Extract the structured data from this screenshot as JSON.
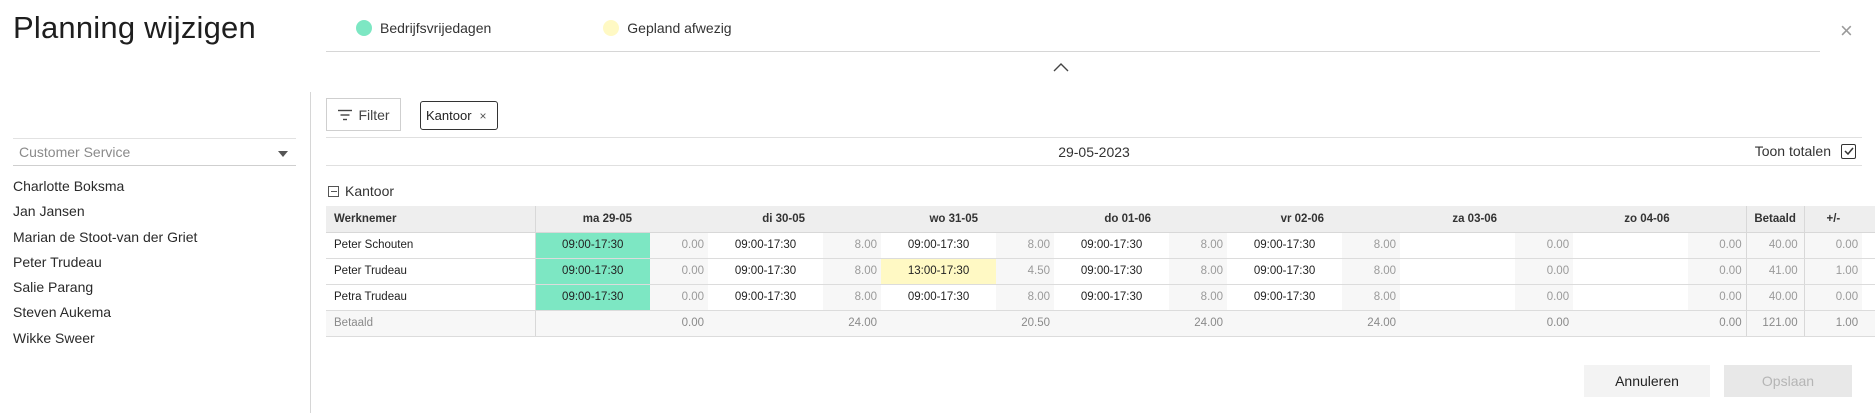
{
  "title": "Planning wijzigen",
  "close_label": "×",
  "legend": [
    {
      "label": "Bedrijfsvrijedagen",
      "color": "#7de7c3"
    },
    {
      "label": "Gepland afwezig",
      "color": "#fff9c4"
    }
  ],
  "sidebar": {
    "department_select": {
      "value": "Customer Service"
    },
    "employees": [
      "Charlotte Boksma",
      "Jan Jansen",
      "Marian de Stoot-van der Griet",
      "Peter Trudeau",
      "Salie Parang",
      "Steven Aukema",
      "Wikke Sweer"
    ]
  },
  "toolbar": {
    "filter_label": "Filter",
    "chip_label": "Kantoor",
    "chip_remove": "×"
  },
  "date_bar": {
    "date": "29-05-2023",
    "toggle_label": "Toon totalen",
    "toggle_checked": true
  },
  "group": {
    "label": "Kantoor"
  },
  "table": {
    "headers": {
      "employee": "Werknemer",
      "days": [
        "ma 29-05",
        "di 30-05",
        "wo 31-05",
        "do 01-06",
        "vr 02-06",
        "za 03-06",
        "zo 04-06"
      ],
      "paid": "Betaald",
      "diff": "+/-"
    },
    "rows": [
      {
        "name": "Peter Schouten",
        "cells": [
          {
            "time": "09:00-17:30",
            "hours": "0.00",
            "type": "green"
          },
          {
            "time": "09:00-17:30",
            "hours": "8.00",
            "type": ""
          },
          {
            "time": "09:00-17:30",
            "hours": "8.00",
            "type": ""
          },
          {
            "time": "09:00-17:30",
            "hours": "8.00",
            "type": ""
          },
          {
            "time": "09:00-17:30",
            "hours": "8.00",
            "type": ""
          },
          {
            "time": "",
            "hours": "0.00",
            "type": ""
          },
          {
            "time": "",
            "hours": "0.00",
            "type": ""
          }
        ],
        "paid": "40.00",
        "diff": "0.00"
      },
      {
        "name": "Peter Trudeau",
        "cells": [
          {
            "time": "09:00-17:30",
            "hours": "0.00",
            "type": "green"
          },
          {
            "time": "09:00-17:30",
            "hours": "8.00",
            "type": ""
          },
          {
            "time": "13:00-17:30",
            "hours": "4.50",
            "type": "yellow"
          },
          {
            "time": "09:00-17:30",
            "hours": "8.00",
            "type": ""
          },
          {
            "time": "09:00-17:30",
            "hours": "8.00",
            "type": ""
          },
          {
            "time": "",
            "hours": "0.00",
            "type": ""
          },
          {
            "time": "",
            "hours": "0.00",
            "type": ""
          }
        ],
        "paid": "41.00",
        "diff": "1.00"
      },
      {
        "name": "Petra Trudeau",
        "cells": [
          {
            "time": "09:00-17:30",
            "hours": "0.00",
            "type": "green"
          },
          {
            "time": "09:00-17:30",
            "hours": "8.00",
            "type": ""
          },
          {
            "time": "09:00-17:30",
            "hours": "8.00",
            "type": ""
          },
          {
            "time": "09:00-17:30",
            "hours": "8.00",
            "type": ""
          },
          {
            "time": "09:00-17:30",
            "hours": "8.00",
            "type": ""
          },
          {
            "time": "",
            "hours": "0.00",
            "type": ""
          },
          {
            "time": "",
            "hours": "0.00",
            "type": ""
          }
        ],
        "paid": "40.00",
        "diff": "0.00"
      }
    ],
    "totals": {
      "label": "Betaald",
      "days": [
        "0.00",
        "24.00",
        "20.50",
        "24.00",
        "24.00",
        "0.00",
        "0.00"
      ],
      "paid": "121.00",
      "diff": "1.00"
    },
    "delete_icon": "trash-icon"
  },
  "footer": {
    "cancel_label": "Annuleren",
    "save_label": "Opslaan"
  }
}
